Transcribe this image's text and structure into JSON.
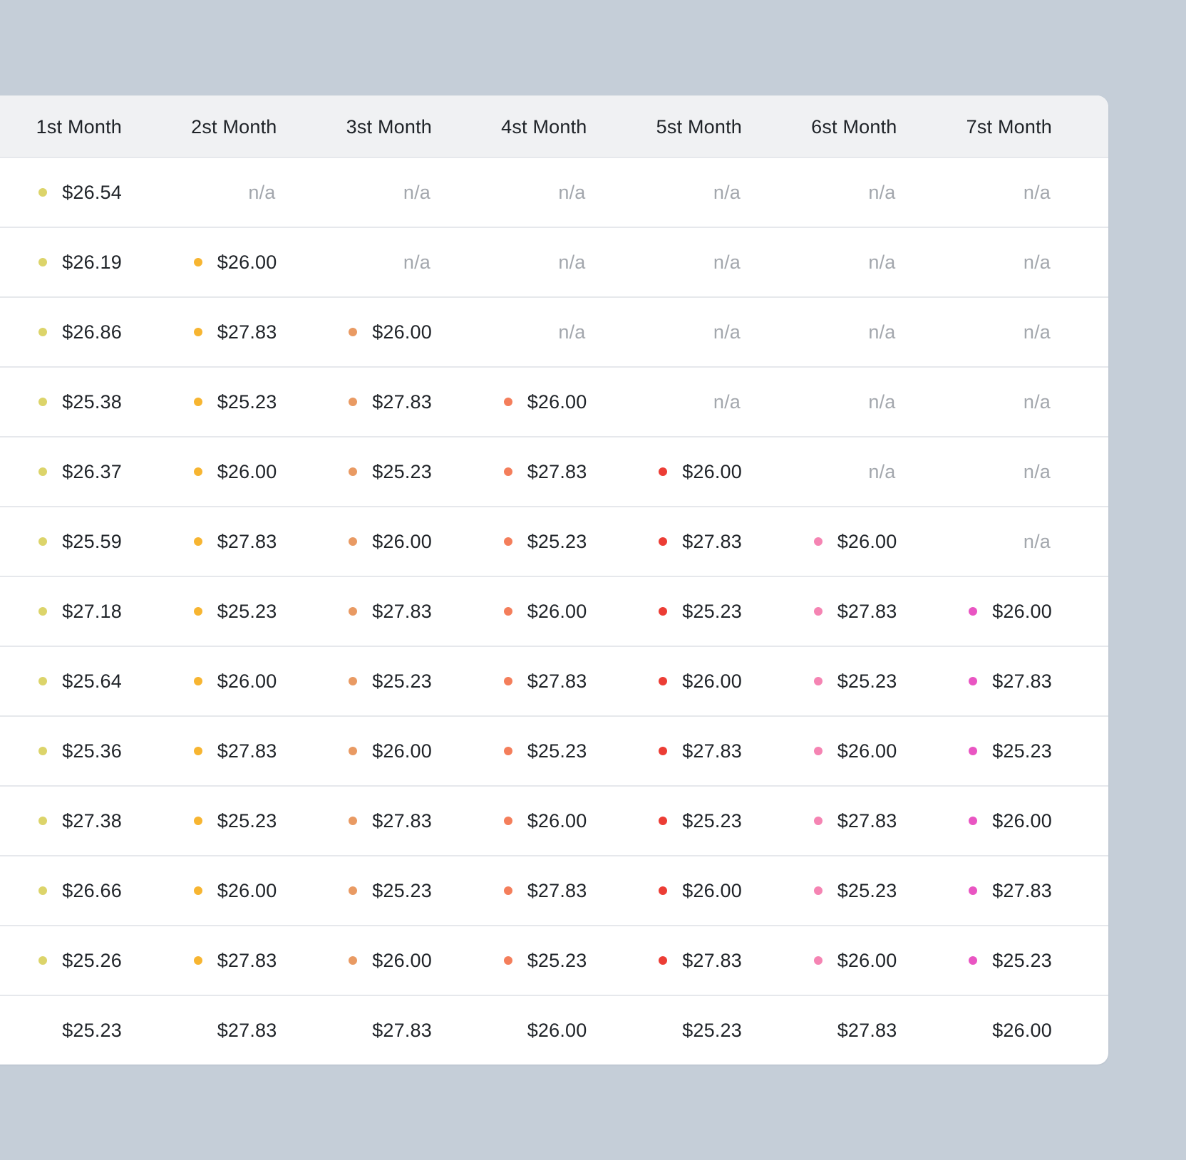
{
  "table": {
    "columns": [
      "1st Month",
      "2st Month",
      "3st Month",
      "4st Month",
      "5st Month",
      "6st Month",
      "7st Month"
    ],
    "dot_colors": [
      "#dcd46a",
      "#f7b531",
      "#e99a63",
      "#f47e5b",
      "#ec3d35",
      "#f584b3",
      "#e955c2"
    ],
    "rows": [
      [
        "$26.54",
        "n/a",
        "n/a",
        "n/a",
        "n/a",
        "n/a",
        "n/a"
      ],
      [
        "$26.19",
        "$26.00",
        "n/a",
        "n/a",
        "n/a",
        "n/a",
        "n/a"
      ],
      [
        "$26.86",
        "$27.83",
        "$26.00",
        "n/a",
        "n/a",
        "n/a",
        "n/a"
      ],
      [
        "$25.38",
        "$25.23",
        "$27.83",
        "$26.00",
        "n/a",
        "n/a",
        "n/a"
      ],
      [
        "$26.37",
        "$26.00",
        "$25.23",
        "$27.83",
        "$26.00",
        "n/a",
        "n/a"
      ],
      [
        "$25.59",
        "$27.83",
        "$26.00",
        "$25.23",
        "$27.83",
        "$26.00",
        "n/a"
      ],
      [
        "$27.18",
        "$25.23",
        "$27.83",
        "$26.00",
        "$25.23",
        "$27.83",
        "$26.00"
      ],
      [
        "$25.64",
        "$26.00",
        "$25.23",
        "$27.83",
        "$26.00",
        "$25.23",
        "$27.83"
      ],
      [
        "$25.36",
        "$27.83",
        "$26.00",
        "$25.23",
        "$27.83",
        "$26.00",
        "$25.23"
      ],
      [
        "$27.38",
        "$25.23",
        "$27.83",
        "$26.00",
        "$25.23",
        "$27.83",
        "$26.00"
      ],
      [
        "$26.66",
        "$26.00",
        "$25.23",
        "$27.83",
        "$26.00",
        "$25.23",
        "$27.83"
      ],
      [
        "$25.26",
        "$27.83",
        "$26.00",
        "$25.23",
        "$27.83",
        "$26.00",
        "$25.23"
      ]
    ],
    "totals": [
      "$25.23",
      "$27.83",
      "$27.83",
      "$26.00",
      "$25.23",
      "$27.83",
      "$26.00"
    ]
  }
}
